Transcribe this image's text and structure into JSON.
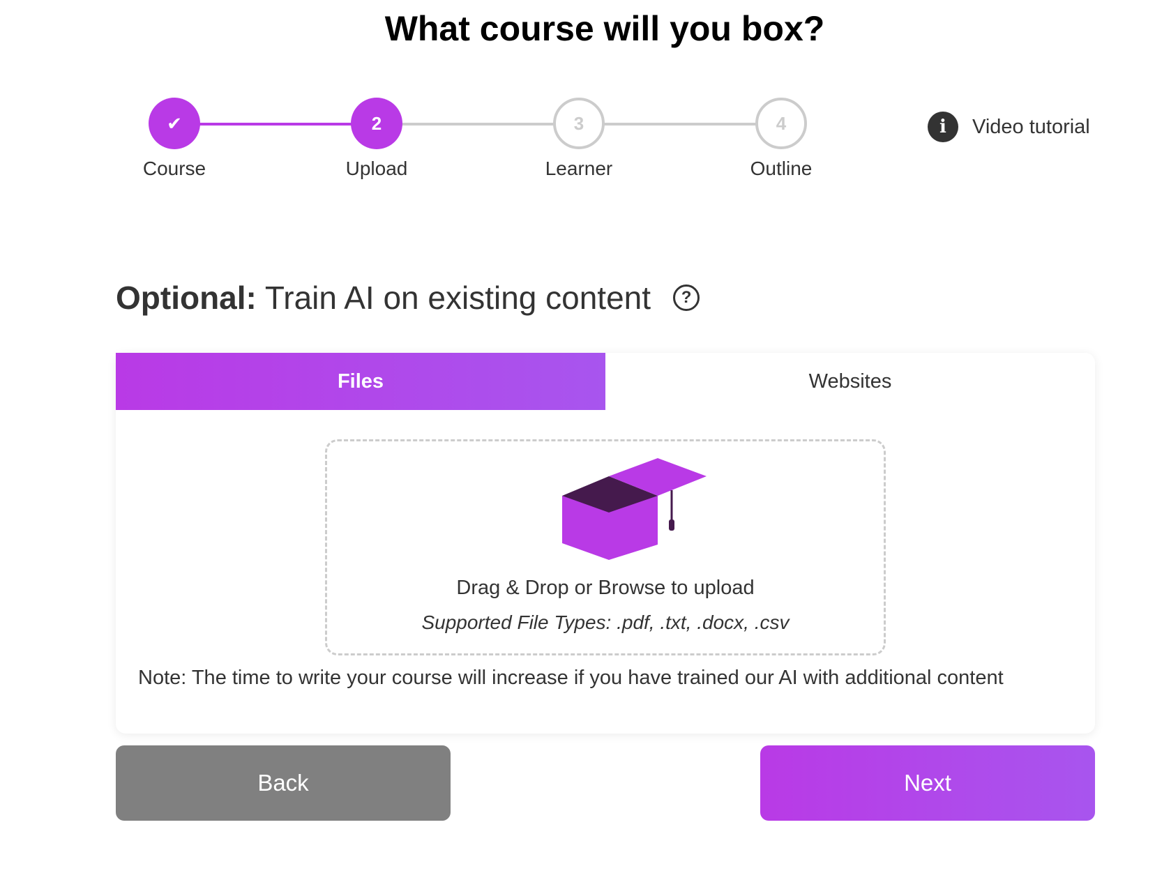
{
  "header": {
    "title": "What course will you box?"
  },
  "stepper": {
    "steps": [
      {
        "number": "✔",
        "label": "Course",
        "state": "done"
      },
      {
        "number": "2",
        "label": "Upload",
        "state": "current"
      },
      {
        "number": "3",
        "label": "Learner",
        "state": "todo"
      },
      {
        "number": "4",
        "label": "Outline",
        "state": "todo"
      }
    ]
  },
  "video_tutorial": {
    "label": "Video tutorial",
    "icon": "info-icon"
  },
  "section": {
    "bold_label": "Optional:",
    "text": "Train AI on existing content",
    "help_icon": "question-circle-icon"
  },
  "tabs": [
    {
      "label": "Files",
      "active": true
    },
    {
      "label": "Websites",
      "active": false
    }
  ],
  "upload": {
    "icon": "graduation-cap-box-icon",
    "instruction": "Drag & Drop or Browse to upload",
    "supported": "Supported File Types: .pdf, .txt, .docx, .csv"
  },
  "note": "Note: The time to write your course will increase if you have trained our AI with additional content",
  "buttons": {
    "back": "Back",
    "next": "Next"
  },
  "colors": {
    "accent": "#b93ae6",
    "accent_end": "#a855ee",
    "muted": "#cccccc",
    "back_button": "#808080",
    "cap_dark": "#451a4d"
  }
}
